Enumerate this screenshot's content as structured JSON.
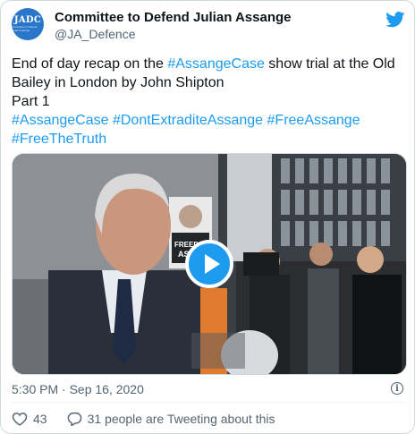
{
  "account": {
    "name": "Committee to Defend Julian Assange",
    "handle": "@JA_Defence",
    "avatar_text": "JADC",
    "avatar_subtext": "Committee to Defend Julian Assange"
  },
  "tweet": {
    "text_plain": "End of day recap on the ",
    "hashtag_inline": "#AssangeCase",
    "text_rest": " show trial at the Old Bailey in London by John Shipton",
    "part": "Part 1",
    "hashtags_line1": [
      "#AssangeCase",
      "#DontExtraditeAssange",
      "#FreeAssange"
    ],
    "hashtags_line2": [
      "#FreeTheTruth"
    ],
    "timestamp": "5:30 PM · Sep 16, 2020"
  },
  "media": {
    "type": "video",
    "sign_text": [
      "FREEDO",
      "ASS"
    ]
  },
  "engagement": {
    "likes": "43",
    "conversation": "31 people are Tweeting about this"
  },
  "icons": [
    "twitter-bird-icon",
    "play-icon",
    "info-icon",
    "heart-icon",
    "reply-icon"
  ],
  "colors": {
    "link": "#1d9bf0",
    "text": "#0f1419",
    "muted": "#536471",
    "border": "#cfd9de"
  }
}
